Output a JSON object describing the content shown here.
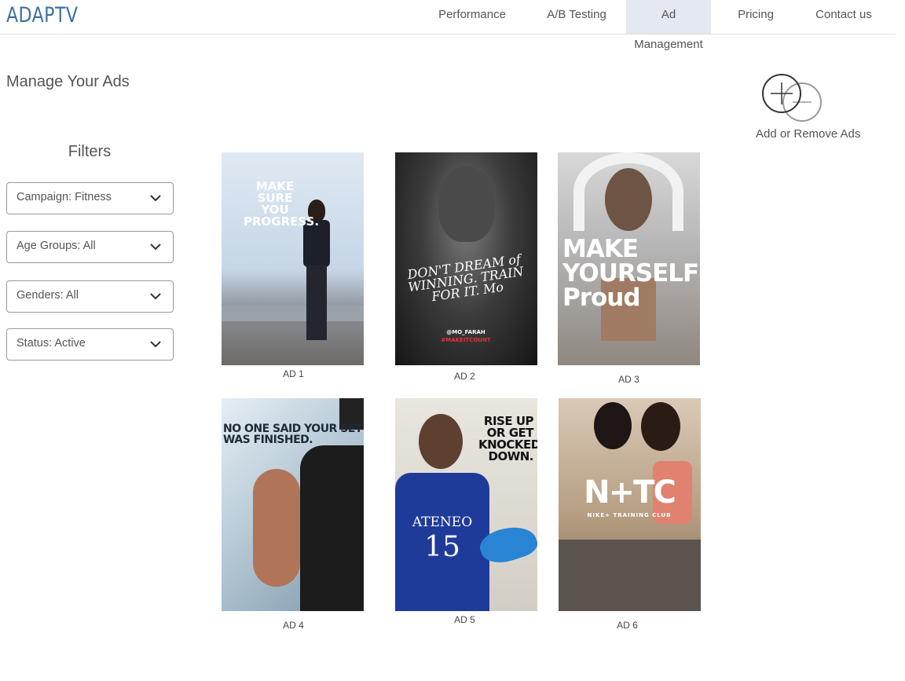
{
  "header": {
    "logo": "ADAPTV",
    "nav": [
      {
        "label": "Performance",
        "active": false
      },
      {
        "label": "A/B Testing",
        "active": false
      },
      {
        "label": "Ad Management",
        "active": true
      },
      {
        "label": "Pricing",
        "active": false
      },
      {
        "label": "Contact us",
        "active": false
      }
    ]
  },
  "page": {
    "title": "Manage Your Ads",
    "add_remove_label": "Add or Remove Ads",
    "add_remove_icon": "add-remove-icon"
  },
  "filters": {
    "title": "Filters",
    "selects": [
      {
        "label": "Campaign: Fitness"
      },
      {
        "label": "Age Groups: All"
      },
      {
        "label": "Genders: All"
      },
      {
        "label": "Status: Active"
      }
    ]
  },
  "ads": [
    {
      "label": "AD 1",
      "poster_text": "MAKE SURE YOU PROGRESS."
    },
    {
      "label": "AD 2",
      "poster_text": "DON'T DREAM of WINNING. TRAIN FOR IT. Mo",
      "handle": "@MO_FARAH",
      "hashtag": "#MAKEITCOUNT"
    },
    {
      "label": "AD 3",
      "poster_text": "MAKE YOURSELF Proud"
    },
    {
      "label": "AD 4",
      "poster_text": "NO ONE SAID YOUR SET WAS FINISHED."
    },
    {
      "label": "AD 5",
      "poster_text": "RISE UP OR GET KNOCKED DOWN.",
      "jersey_text": "ATENEO",
      "jersey_number": "15"
    },
    {
      "label": "AD 6",
      "poster_text": "N+TC",
      "subtext": "NIKE+ TRAINING CLUB"
    }
  ],
  "colors": {
    "brand": "#3d6fa0",
    "active_nav_bg": "#e4e8f0"
  }
}
